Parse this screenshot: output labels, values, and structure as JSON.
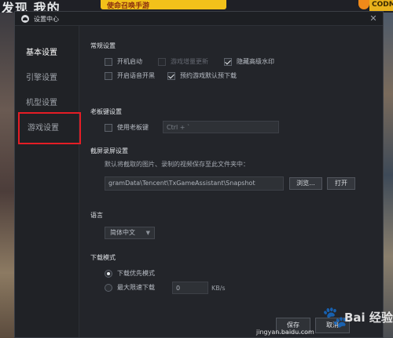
{
  "background": {
    "top_left_text": "发现  我的",
    "top_banner_text": "使命召唤手游",
    "top_right_text": "CODM"
  },
  "dialog": {
    "title": "设置中心",
    "close_glyph": "✕"
  },
  "sidebar": {
    "items": [
      {
        "label": "基本设置"
      },
      {
        "label": "引擎设置"
      },
      {
        "label": "机型设置"
      },
      {
        "label": "游戏设置"
      }
    ]
  },
  "general": {
    "title": "常规设置",
    "autostart": "开机启动",
    "incremental_update": "游戏增量更新",
    "hide_watermark": "隐藏高级水印",
    "voice_on": "开启语音开黑",
    "predownload": "预约游戏默认预下载"
  },
  "boss_key": {
    "title": "老板键设置",
    "use_label": "使用老板键",
    "shortcut": "Ctrl + `"
  },
  "capture": {
    "title": "截屏录屏设置",
    "hint": "默认将截取的图片、录制的视频保存至此文件夹中：",
    "path": "gramData\\Tencent\\TxGameAssistant\\Snapshot",
    "browse": "浏览...",
    "open": "打开"
  },
  "language": {
    "title": "语言",
    "selected": "简体中文",
    "arrow": "▼"
  },
  "download": {
    "title": "下载模式",
    "priority": "下载优先模式",
    "max_speed": "最大限速下载",
    "speed_value": "0",
    "unit": "KB/s"
  },
  "footer": {
    "save": "保存",
    "cancel": "取消"
  },
  "watermark": {
    "brand": "Bai 经验",
    "url": "jingyan.baidu.com"
  }
}
